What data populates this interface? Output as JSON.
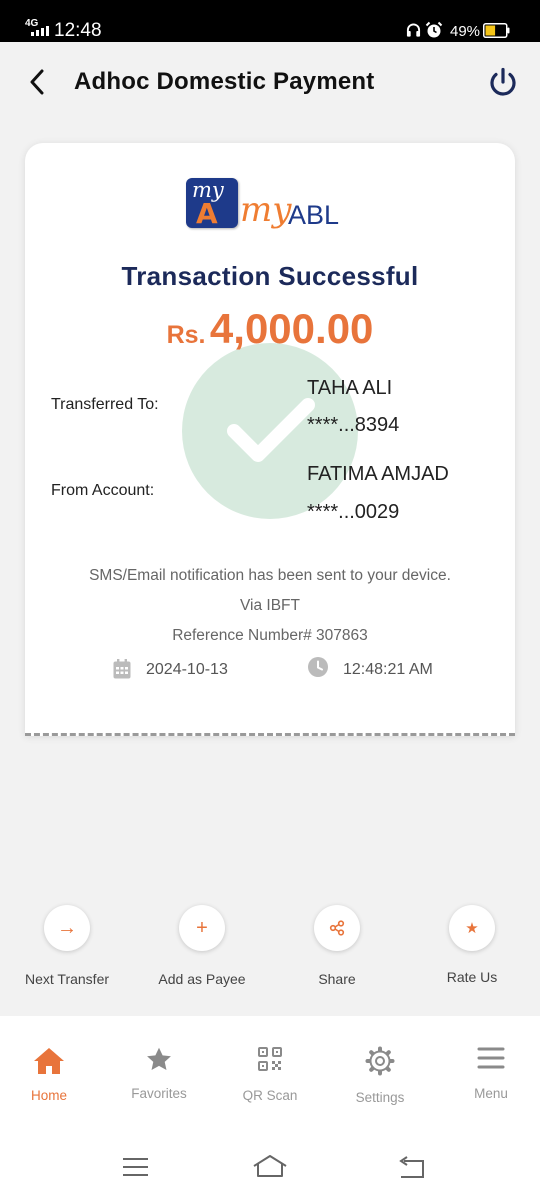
{
  "status_bar": {
    "network": "4G",
    "time": "12:48",
    "battery_percent": "49%",
    "battery_level": 0.49
  },
  "header": {
    "title": "Adhoc Domestic Payment"
  },
  "logo": {
    "text_my_box": "my",
    "text_a": "A",
    "text_my": "my",
    "text_abl": "ABL"
  },
  "receipt": {
    "title": "Transaction Successful",
    "currency": "Rs.",
    "amount": "4,000.00",
    "transferred_to_label": "Transferred To:",
    "transferred_to_name": "TAHA ALI",
    "transferred_to_account": "****...8394",
    "from_account_label": "From Account:",
    "from_account_name": "FATIMA AMJAD",
    "from_account_number": "****...0029",
    "notification": "SMS/Email notification has been sent to your device.",
    "via": "Via IBFT",
    "reference": "Reference Number# 307863",
    "date": "2024-10-13",
    "time": "12:48:21 AM"
  },
  "actions": [
    {
      "label": "Next Transfer",
      "icon": "arrow-right-icon",
      "glyph": "→"
    },
    {
      "label": "Add as Payee",
      "icon": "plus-icon",
      "glyph": "+"
    },
    {
      "label": "Share",
      "icon": "share-icon",
      "glyph": ""
    },
    {
      "label": "Rate Us",
      "icon": "star-icon",
      "glyph": "★"
    }
  ],
  "bottom_nav": [
    {
      "label": "Home",
      "icon": "home-icon",
      "active": true
    },
    {
      "label": "Favorites",
      "icon": "star-icon",
      "active": false
    },
    {
      "label": "QR Scan",
      "icon": "qr-icon",
      "active": false
    },
    {
      "label": "Settings",
      "icon": "gear-icon",
      "active": false
    },
    {
      "label": "Menu",
      "icon": "menu-icon",
      "active": false
    }
  ],
  "colors": {
    "accent": "#e8743b",
    "navy": "#1c2a5a",
    "success_green": "#8cc4a0"
  }
}
